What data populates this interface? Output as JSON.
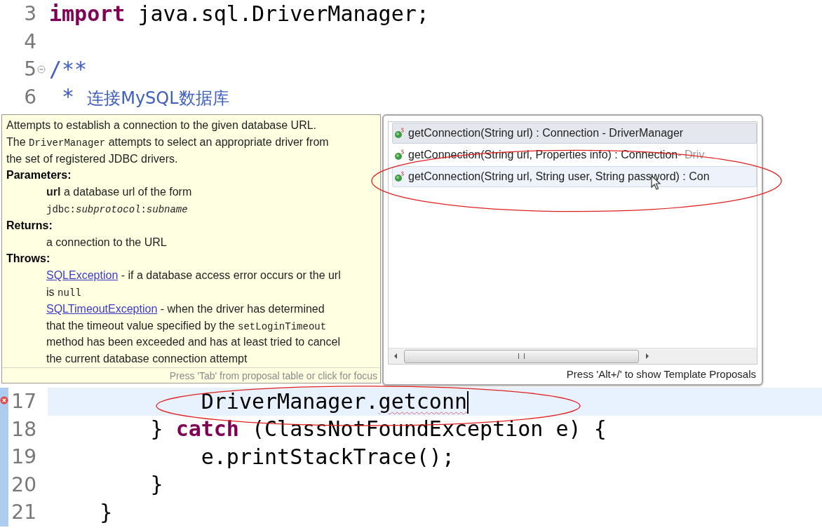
{
  "editor": {
    "lines": [
      {
        "number": "3",
        "tokens": [
          {
            "kind": "keyword",
            "text": "import"
          },
          {
            "kind": "plain",
            "text": " java.sql.DriverManager;"
          }
        ]
      },
      {
        "number": "4"
      },
      {
        "number": "5",
        "collapsed": false,
        "tokens": [
          {
            "kind": "doc",
            "text": "/**"
          }
        ]
      },
      {
        "number": "6",
        "tokens": [
          {
            "kind": "doc",
            "text": " * "
          },
          {
            "kind": "doc-cjk",
            "text": "连接MySQL数据库"
          }
        ]
      },
      {
        "kind": "hidden"
      },
      {
        "number": "17",
        "error": true,
        "current": true,
        "ranged": true,
        "tokens": [
          {
            "kind": "plain",
            "text": "            DriverManager."
          },
          {
            "kind": "misspelled",
            "text": "getconn"
          },
          {
            "kind": "caret"
          }
        ]
      },
      {
        "number": "18",
        "ranged": true,
        "tokens": [
          {
            "kind": "plain",
            "text": "        } "
          },
          {
            "kind": "keyword",
            "text": "catch"
          },
          {
            "kind": "plain",
            "text": " (ClassNotFoundException e) {"
          }
        ]
      },
      {
        "number": "19",
        "ranged": true,
        "tokens": [
          {
            "kind": "plain",
            "text": "            e.printStackTrace();"
          }
        ]
      },
      {
        "number": "20",
        "ranged": true,
        "tokens": [
          {
            "kind": "plain",
            "text": "        }"
          }
        ]
      },
      {
        "number": "21",
        "ranged": true,
        "tokens": [
          {
            "kind": "plain",
            "text": "    }"
          }
        ]
      }
    ]
  },
  "javadoc": {
    "blocks": [
      {
        "kind": "para",
        "segments": [
          {
            "kind": "text",
            "text": "Attempts to establish a connection to the given database URL. The "
          },
          {
            "kind": "code",
            "text": "DriverManager"
          },
          {
            "kind": "text",
            "text": " attempts to select an appropriate driver from the set of registered JDBC drivers."
          }
        ]
      },
      {
        "kind": "heading",
        "text": "Parameters:"
      },
      {
        "kind": "item",
        "segments": [
          {
            "kind": "rich",
            "text": "**url** a database url of the form"
          }
        ]
      },
      {
        "kind": "item",
        "segments": [
          {
            "kind": "code",
            "text": "jdbc:*subprotocol*:*subname*"
          }
        ]
      },
      {
        "kind": "heading",
        "text": "Returns:"
      },
      {
        "kind": "item",
        "segments": [
          {
            "kind": "text",
            "text": "a connection to the URL"
          }
        ]
      },
      {
        "kind": "heading",
        "text": "Throws:"
      },
      {
        "kind": "item",
        "segments": [
          {
            "kind": "link",
            "text": "SQLException"
          },
          {
            "kind": "text",
            "text": " - if a database access error occurs or the url is "
          },
          {
            "kind": "code",
            "text": "null"
          }
        ]
      },
      {
        "kind": "item",
        "segments": [
          {
            "kind": "link",
            "text": "SQLTimeoutException"
          },
          {
            "kind": "text",
            "text": " - when the driver has determined that the timeout value specified by the "
          },
          {
            "kind": "code",
            "text": "setLoginTimeout"
          },
          {
            "kind": "text",
            "text": " method has been exceeded and has at least tried to cancel the current database connection attempt"
          }
        ]
      }
    ],
    "footer": "Press 'Tab' from proposal table or click for focus"
  },
  "proposals": {
    "items": [
      {
        "text": "getConnection(String url) : Connection - DriverManager",
        "selected": true,
        "hovered": false
      },
      {
        "text": "getConnection(String url, Properties info) : Connection",
        "qualifier": " - Driv",
        "selected": false,
        "hovered": false
      },
      {
        "text": "getConnection(String url, String user, String password) : Con",
        "selected": false,
        "hovered": true
      }
    ],
    "footer": "Press 'Alt+/' to show Template Proposals"
  },
  "markup": [
    {
      "kind": "ellipse"
    },
    {
      "kind": "ellipse"
    }
  ]
}
